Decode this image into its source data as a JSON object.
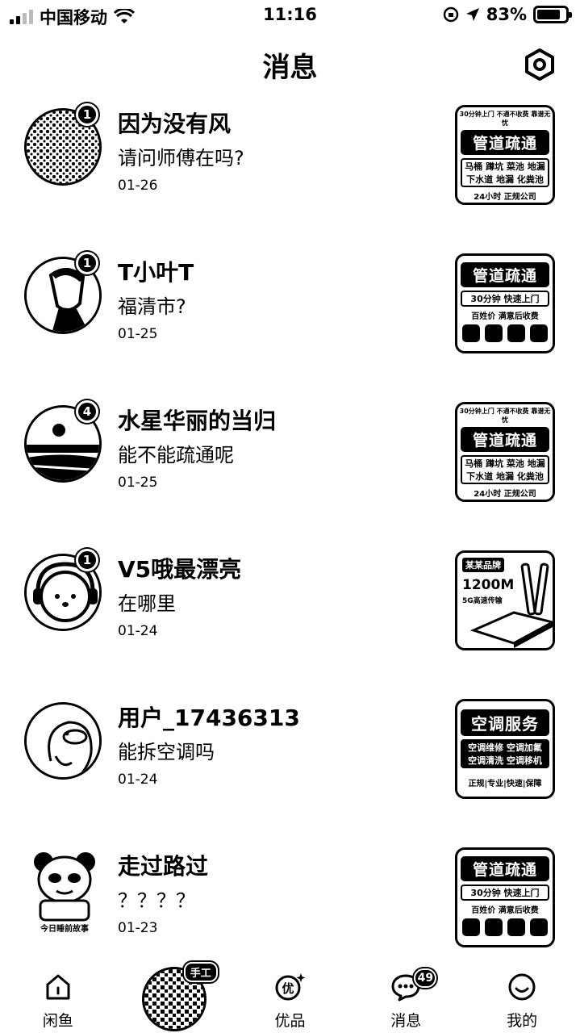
{
  "status_bar": {
    "carrier": "中国移动",
    "time": "11:16",
    "battery": "83%",
    "battery_level": 0.83
  },
  "header": {
    "title": "消息"
  },
  "conversations": [
    {
      "name": "因为没有风",
      "message": "请问师傅在吗?",
      "date": "01-26",
      "badge": "1",
      "thumb": "pipe-a"
    },
    {
      "name": "T小叶T",
      "message": "福清市?",
      "date": "01-25",
      "badge": "1",
      "thumb": "pipe-b"
    },
    {
      "name": "水星华丽的当归",
      "message": "能不能疏通呢",
      "date": "01-25",
      "badge": "4",
      "thumb": "pipe-a"
    },
    {
      "name": "V5哦最漂亮",
      "message": "在哪里",
      "date": "01-24",
      "badge": "1",
      "thumb": "wifi"
    },
    {
      "name": "用户_17436313",
      "message": "能拆空调吗",
      "date": "01-24",
      "badge": "",
      "thumb": "ac"
    },
    {
      "name": "走过路过",
      "message": "？？？？",
      "date": "01-23",
      "badge": "",
      "thumb": "pipe-b"
    }
  ],
  "thumbnails": {
    "pipe_top": "30分钟上门 不通不收费 靠谱无忧",
    "pipe_head": "管道疏通",
    "pipe_sub_a": "马桶 蹲坑 菜池 地漏 下水道 地漏 化粪池",
    "pipe_foot_a": "24小时 正规公司",
    "pipe_sub_b": "30分钟 快速上门",
    "pipe_foot_b": "百姓价 满意后收费",
    "wifi_brand": "某某品牌",
    "wifi_speed": "1200M",
    "wifi_sub": "5G高速传输",
    "ac_head": "空调服务",
    "ac_sub": "空调维修 空调加氟 空调清洗 空调移机",
    "ac_foot": "正规|专业|快速|保障"
  },
  "tabbar": {
    "tabs": [
      {
        "label": "闲鱼",
        "icon": "home-icon"
      },
      {
        "label": "",
        "icon": "center-avatar"
      },
      {
        "label": "优品",
        "icon": "youpin-icon"
      },
      {
        "label": "消息",
        "icon": "chat-icon",
        "badge": "49"
      },
      {
        "label": "我的",
        "icon": "smile-icon"
      }
    ],
    "center_tag": "手工"
  },
  "sticker_text": "今日睡前故事"
}
